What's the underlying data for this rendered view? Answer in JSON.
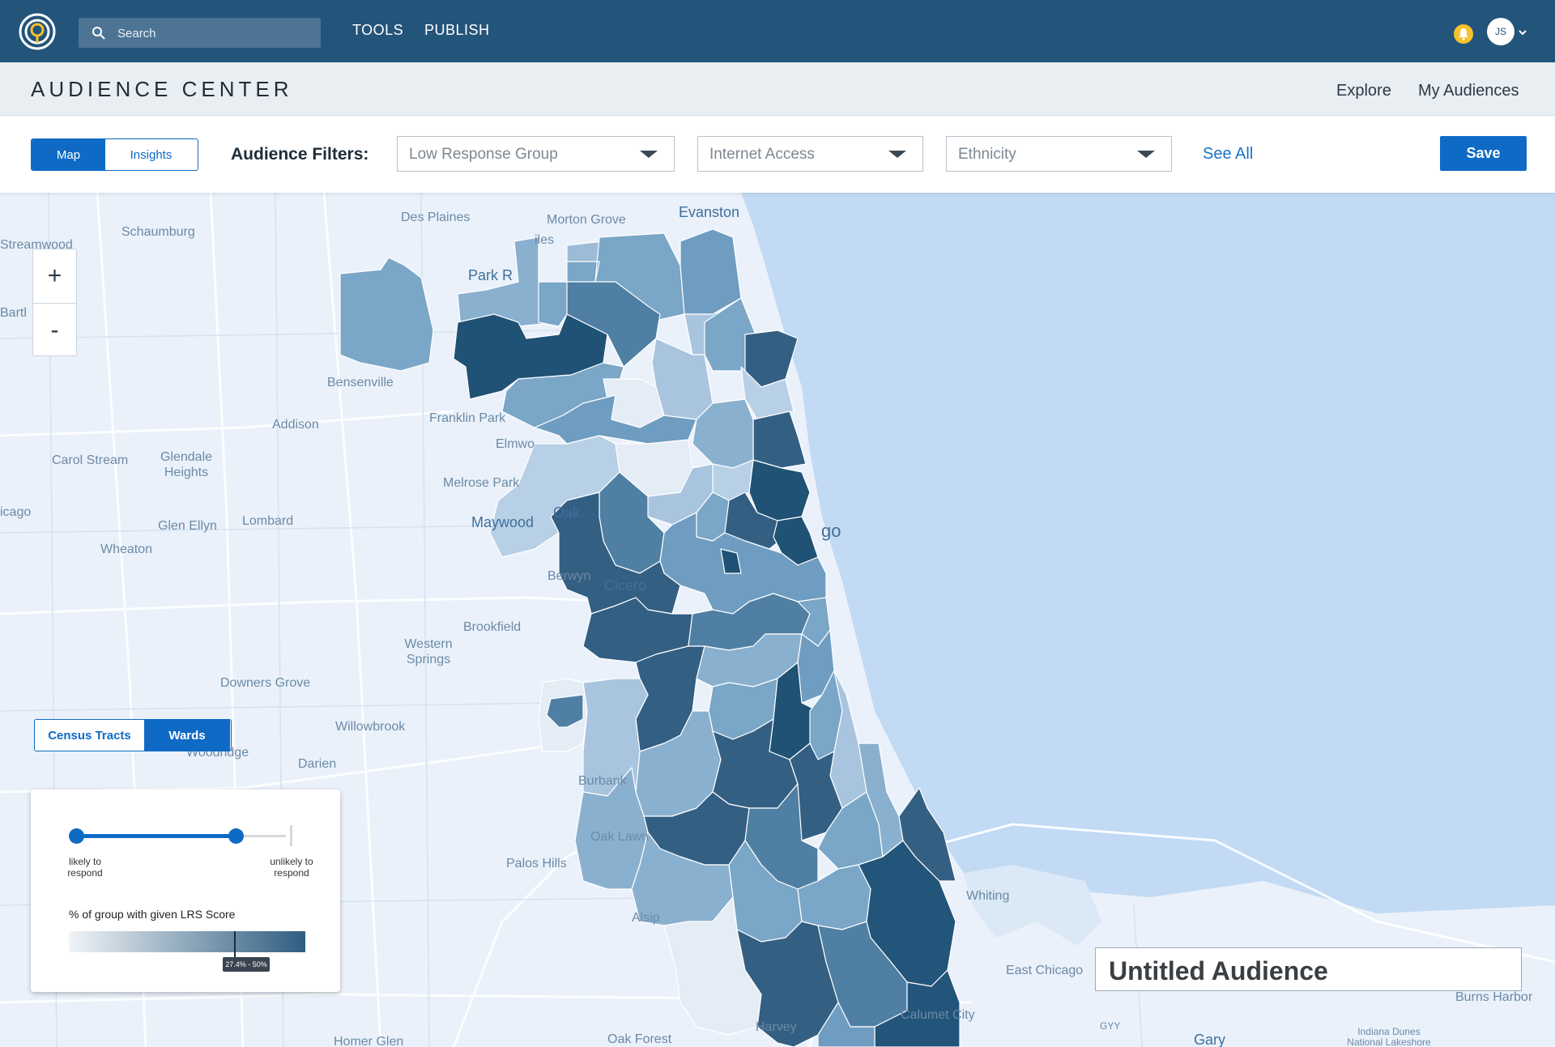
{
  "topnav": {
    "search_placeholder": "Search",
    "links": [
      "TOOLS",
      "PUBLISH"
    ],
    "avatar_initials": "JS"
  },
  "subheader": {
    "title": "AUDIENCE CENTER",
    "links": [
      "Explore",
      "My Audiences"
    ]
  },
  "filterbar": {
    "view_toggle": [
      "Map",
      "Insights"
    ],
    "view_selected": "Map",
    "label": "Audience Filters:",
    "dropdowns": [
      "Low Response Group",
      "Internet Access",
      "Ethnicity"
    ],
    "see_all": "See All",
    "save": "Save"
  },
  "map": {
    "zoom_in": "+",
    "zoom_out": "-",
    "layer_toggle": [
      "Census Tracts",
      "Wards"
    ],
    "layer_selected": "Wards",
    "labels": {
      "schaumburg": "Schaumburg",
      "des_plaines": "Des Plaines",
      "morton_grove": "Morton Grove",
      "evanston": "Evanston",
      "streamwood": "Streamwood",
      "bartlett": "Bartl",
      "park_ridge": "Park R",
      "niles": "iles",
      "bensenville": "Bensenville",
      "addison": "Addison",
      "franklin_park": "Franklin Park",
      "elmwood": "Elmwo",
      "carol_stream": "Carol Stream",
      "glendale_heights": "Glendale Heights",
      "melrose_park": "Melrose Park",
      "chicago_left": "icago",
      "glen_ellyn": "Glen Ellyn",
      "lombard": "Lombard",
      "maywood": "Maywood",
      "oak": "Oak",
      "chicago_city": "go",
      "wheaton": "Wheaton",
      "berwyn": "Berwyn",
      "cicero": "Cicero",
      "brookfield": "Brookfield",
      "western_springs": "Western Springs",
      "downers_grove": "Downers Grove",
      "willowbrook": "Willowbrook",
      "woodridge": "Woodridge",
      "darien": "Darien",
      "burbank": "Burbank",
      "oak_lawn": "Oak Lawn",
      "palos_hills": "Palos Hills",
      "alsip": "Alsip",
      "whiting": "Whiting",
      "east_chicago": "East Chicago",
      "burns_harbor": "Burns Harbor",
      "calumet_city": "Calumet City",
      "harvey": "Harvey",
      "oak_forest": "Oak Forest",
      "homer_glen": "Homer Glen",
      "gary": "Gary",
      "gyy": "GYY",
      "indiana_dunes": "Indiana Dunes National Lakeshore"
    }
  },
  "legend": {
    "left_label": "likely to respond",
    "right_label": "unlikely to respond",
    "slider_low": 0,
    "slider_high": 0.75,
    "heading": "% of group with given LRS Score",
    "range_tag": "27.4% - 50%",
    "gradient_start": "#f1f4f7",
    "gradient_end": "#2e5d80"
  },
  "audience_title": "Untitled Audience",
  "colors": {
    "nav": "#23547a",
    "accent": "#0f6ac6",
    "lake": "#c2daf3",
    "land": "#eaf1fa"
  }
}
